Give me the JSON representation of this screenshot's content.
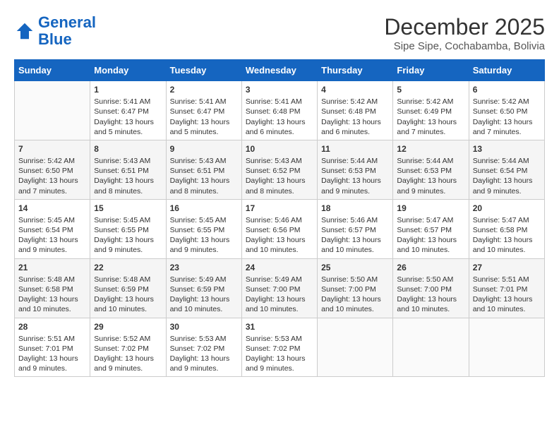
{
  "header": {
    "logo_line1": "General",
    "logo_line2": "Blue",
    "month_title": "December 2025",
    "subtitle": "Sipe Sipe, Cochabamba, Bolivia"
  },
  "days_of_week": [
    "Sunday",
    "Monday",
    "Tuesday",
    "Wednesday",
    "Thursday",
    "Friday",
    "Saturday"
  ],
  "weeks": [
    [
      {
        "day": "",
        "data": ""
      },
      {
        "day": "1",
        "data": "Sunrise: 5:41 AM\nSunset: 6:47 PM\nDaylight: 13 hours\nand 5 minutes."
      },
      {
        "day": "2",
        "data": "Sunrise: 5:41 AM\nSunset: 6:47 PM\nDaylight: 13 hours\nand 5 minutes."
      },
      {
        "day": "3",
        "data": "Sunrise: 5:41 AM\nSunset: 6:48 PM\nDaylight: 13 hours\nand 6 minutes."
      },
      {
        "day": "4",
        "data": "Sunrise: 5:42 AM\nSunset: 6:48 PM\nDaylight: 13 hours\nand 6 minutes."
      },
      {
        "day": "5",
        "data": "Sunrise: 5:42 AM\nSunset: 6:49 PM\nDaylight: 13 hours\nand 7 minutes."
      },
      {
        "day": "6",
        "data": "Sunrise: 5:42 AM\nSunset: 6:50 PM\nDaylight: 13 hours\nand 7 minutes."
      }
    ],
    [
      {
        "day": "7",
        "data": "Sunrise: 5:42 AM\nSunset: 6:50 PM\nDaylight: 13 hours\nand 7 minutes."
      },
      {
        "day": "8",
        "data": "Sunrise: 5:43 AM\nSunset: 6:51 PM\nDaylight: 13 hours\nand 8 minutes."
      },
      {
        "day": "9",
        "data": "Sunrise: 5:43 AM\nSunset: 6:51 PM\nDaylight: 13 hours\nand 8 minutes."
      },
      {
        "day": "10",
        "data": "Sunrise: 5:43 AM\nSunset: 6:52 PM\nDaylight: 13 hours\nand 8 minutes."
      },
      {
        "day": "11",
        "data": "Sunrise: 5:44 AM\nSunset: 6:53 PM\nDaylight: 13 hours\nand 9 minutes."
      },
      {
        "day": "12",
        "data": "Sunrise: 5:44 AM\nSunset: 6:53 PM\nDaylight: 13 hours\nand 9 minutes."
      },
      {
        "day": "13",
        "data": "Sunrise: 5:44 AM\nSunset: 6:54 PM\nDaylight: 13 hours\nand 9 minutes."
      }
    ],
    [
      {
        "day": "14",
        "data": "Sunrise: 5:45 AM\nSunset: 6:54 PM\nDaylight: 13 hours\nand 9 minutes."
      },
      {
        "day": "15",
        "data": "Sunrise: 5:45 AM\nSunset: 6:55 PM\nDaylight: 13 hours\nand 9 minutes."
      },
      {
        "day": "16",
        "data": "Sunrise: 5:45 AM\nSunset: 6:55 PM\nDaylight: 13 hours\nand 9 minutes."
      },
      {
        "day": "17",
        "data": "Sunrise: 5:46 AM\nSunset: 6:56 PM\nDaylight: 13 hours\nand 10 minutes."
      },
      {
        "day": "18",
        "data": "Sunrise: 5:46 AM\nSunset: 6:57 PM\nDaylight: 13 hours\nand 10 minutes."
      },
      {
        "day": "19",
        "data": "Sunrise: 5:47 AM\nSunset: 6:57 PM\nDaylight: 13 hours\nand 10 minutes."
      },
      {
        "day": "20",
        "data": "Sunrise: 5:47 AM\nSunset: 6:58 PM\nDaylight: 13 hours\nand 10 minutes."
      }
    ],
    [
      {
        "day": "21",
        "data": "Sunrise: 5:48 AM\nSunset: 6:58 PM\nDaylight: 13 hours\nand 10 minutes."
      },
      {
        "day": "22",
        "data": "Sunrise: 5:48 AM\nSunset: 6:59 PM\nDaylight: 13 hours\nand 10 minutes."
      },
      {
        "day": "23",
        "data": "Sunrise: 5:49 AM\nSunset: 6:59 PM\nDaylight: 13 hours\nand 10 minutes."
      },
      {
        "day": "24",
        "data": "Sunrise: 5:49 AM\nSunset: 7:00 PM\nDaylight: 13 hours\nand 10 minutes."
      },
      {
        "day": "25",
        "data": "Sunrise: 5:50 AM\nSunset: 7:00 PM\nDaylight: 13 hours\nand 10 minutes."
      },
      {
        "day": "26",
        "data": "Sunrise: 5:50 AM\nSunset: 7:00 PM\nDaylight: 13 hours\nand 10 minutes."
      },
      {
        "day": "27",
        "data": "Sunrise: 5:51 AM\nSunset: 7:01 PM\nDaylight: 13 hours\nand 10 minutes."
      }
    ],
    [
      {
        "day": "28",
        "data": "Sunrise: 5:51 AM\nSunset: 7:01 PM\nDaylight: 13 hours\nand 9 minutes."
      },
      {
        "day": "29",
        "data": "Sunrise: 5:52 AM\nSunset: 7:02 PM\nDaylight: 13 hours\nand 9 minutes."
      },
      {
        "day": "30",
        "data": "Sunrise: 5:53 AM\nSunset: 7:02 PM\nDaylight: 13 hours\nand 9 minutes."
      },
      {
        "day": "31",
        "data": "Sunrise: 5:53 AM\nSunset: 7:02 PM\nDaylight: 13 hours\nand 9 minutes."
      },
      {
        "day": "",
        "data": ""
      },
      {
        "day": "",
        "data": ""
      },
      {
        "day": "",
        "data": ""
      }
    ]
  ]
}
